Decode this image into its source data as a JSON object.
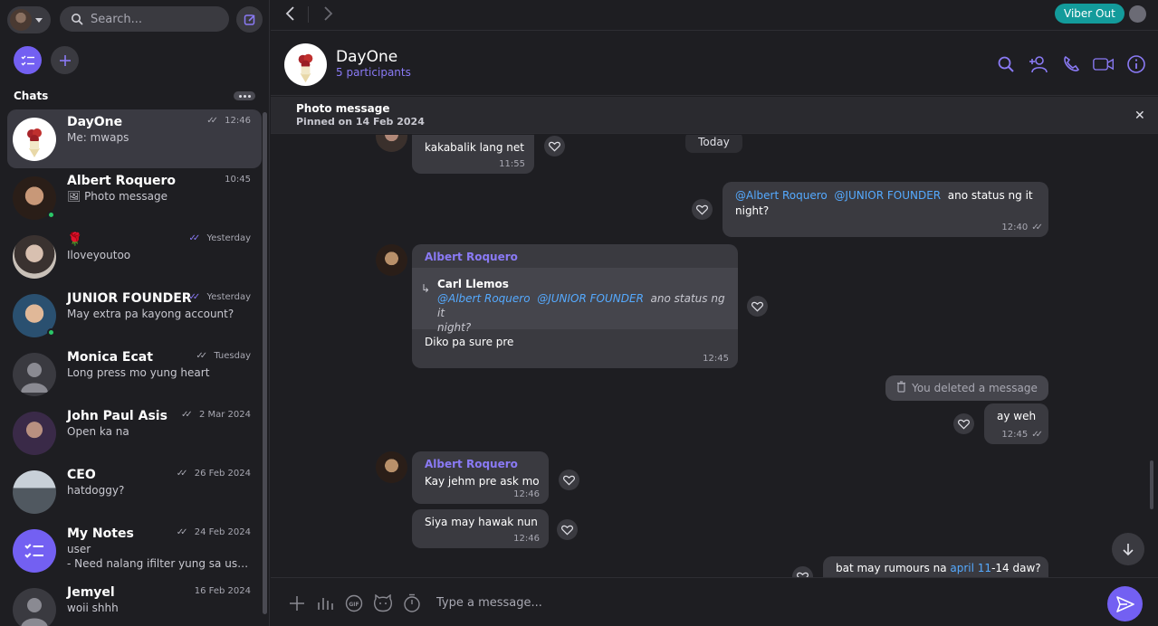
{
  "search": {
    "placeholder": "Search..."
  },
  "sidebar": {
    "section_title": "Chats",
    "chats": [
      {
        "name": "DayOne",
        "preview": "Me: mwaps",
        "time": "12:46",
        "ticks": "read-grey",
        "online": false
      },
      {
        "name": "Albert Roquero",
        "preview": "Photo message",
        "time": "10:45",
        "ticks": "",
        "online": true
      },
      {
        "name": "🌹",
        "preview": "Iloveyoutoo",
        "time": "Yesterday",
        "ticks": "read-purple",
        "online": false
      },
      {
        "name": "JUNIOR FOUNDER",
        "preview": "May extra pa kayong account?",
        "time": "Yesterday",
        "ticks": "read-purple",
        "online": true
      },
      {
        "name": "Monica Ecat",
        "preview": "Long press mo yung heart",
        "time": "Tuesday",
        "ticks": "read-grey",
        "online": false
      },
      {
        "name": "John Paul Asis",
        "preview": "Open ka na",
        "time": "2 Mar 2024",
        "ticks": "read-grey",
        "online": false
      },
      {
        "name": "CEO",
        "preview": "hatdoggy?",
        "time": "26 Feb 2024",
        "ticks": "read-grey",
        "online": false
      },
      {
        "name": "My Notes",
        "preview": "user",
        "preview2": "- Need nalang ifilter yung sa use...",
        "time": "24 Feb 2024",
        "ticks": "read-grey",
        "online": false
      },
      {
        "name": "Jemyel",
        "preview": "woii shhh",
        "time": "16 Feb 2024",
        "ticks": "",
        "online": false
      }
    ]
  },
  "topbar": {
    "viber_out": "Viber Out"
  },
  "conversation": {
    "title": "DayOne",
    "subtitle": "5 participants",
    "pinned": {
      "title": "Photo message",
      "date": "Pinned on 14 Feb 2024"
    },
    "date_separator": "Today",
    "messages": {
      "m1": {
        "text": "kakabalik lang net",
        "time": "11:55"
      },
      "m2": {
        "mention1": "@Albert Roquero",
        "mention2": "@JUNIOR FOUNDER",
        "text_a": " ano status ng it",
        "text_b": "night?",
        "time": "12:40"
      },
      "m3": {
        "sender": "Albert Roquero",
        "reply_name": "Carl Llemos",
        "reply_mention1": "@Albert Roquero",
        "reply_mention2": "@JUNIOR FOUNDER",
        "reply_text_a": " ano status ng it",
        "reply_text_b": "night?",
        "text": "Diko pa sure pre",
        "time": "12:45"
      },
      "m4": {
        "text": "You deleted a message"
      },
      "m5": {
        "text": "ay weh",
        "time": "12:45"
      },
      "m6": {
        "sender": "Albert Roquero",
        "text": "Kay jehm pre ask mo",
        "time": "12:46"
      },
      "m7": {
        "text": "Siya may hawak nun",
        "time": "12:46"
      },
      "m8": {
        "text_a": "bat may rumours na ",
        "link": "april 11",
        "text_b": "-14 daw?"
      }
    }
  },
  "composer": {
    "placeholder": "Type a message..."
  },
  "colors": {
    "accent": "#7360f2",
    "viber_out": "#139b9b",
    "mention": "#55aaff",
    "online": "#2bc768"
  }
}
